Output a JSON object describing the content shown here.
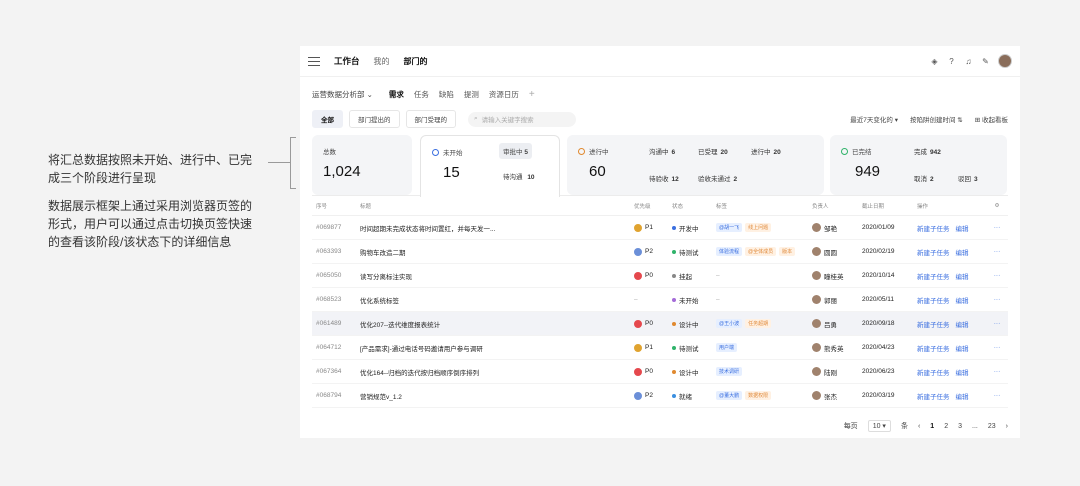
{
  "annotations": {
    "line1": "将汇总数据按照未开始、进行中、已完成三个阶段进行呈现",
    "line2": "数据展示框架上通过采用浏览器页签的形式，用户可以通过点击切换页签快速的查看该阶段/该状态下的详细信息"
  },
  "topbar": {
    "workbench": "工作台",
    "mine": "我的",
    "department": "部门的"
  },
  "subnav": {
    "project": "运营数据分析部",
    "tabs": [
      "需求",
      "任务",
      "缺陷",
      "提测",
      "资源日历"
    ],
    "plus": "+"
  },
  "filters": {
    "pills": [
      "全部",
      "部门提出的",
      "部门受理的"
    ],
    "search_placeholder": "请输入关键字搜索",
    "recent": "最近7天变化的",
    "sort": "按陷阱创建时间",
    "collapse": "收起看板"
  },
  "cards": {
    "total": {
      "label": "总数",
      "value": "1,024"
    },
    "not_started": {
      "label": "未开始",
      "value": "15",
      "sub1_label": "审批中",
      "sub1_value": "5",
      "sub2_label": "待沟通",
      "sub2_value": "10"
    },
    "in_progress": {
      "label": "进行中",
      "value": "60",
      "s1l": "沟通中",
      "s1v": "6",
      "s2l": "已受理",
      "s2v": "20",
      "s3l": "进行中",
      "s3v": "20",
      "s4l": "待验收",
      "s4v": "12",
      "s5l": "验收未通过",
      "s5v": "2"
    },
    "done": {
      "label": "已完结",
      "value": "949",
      "s1l": "完成",
      "s1v": "942",
      "s2l": "取消",
      "s2v": "2",
      "s3l": "驳回",
      "s3v": "3"
    }
  },
  "table": {
    "headers": [
      "序号",
      "标题",
      "优先级",
      "状态",
      "标签",
      "负责人",
      "截止日期",
      "操作"
    ],
    "rows": [
      {
        "id": "#069877",
        "title": "时间超期未完成状态将时间置红，并每天发一...",
        "pri": "P1",
        "status": "开发中",
        "tags": [
          "@胡一飞",
          "线上问题"
        ],
        "owner": "邹艳",
        "date": "2020/01/09"
      },
      {
        "id": "#063393",
        "title": "购物车改造二期",
        "pri": "P2",
        "status": "待测试",
        "tags": [
          "体验流程",
          "@全体成员",
          "版本"
        ],
        "owner": "圆圆",
        "date": "2020/02/19"
      },
      {
        "id": "#065050",
        "title": "读写分离标注实现",
        "pri": "P0",
        "status": "挂起",
        "tags": [
          "–"
        ],
        "owner": "瞳桂英",
        "date": "2020/10/14"
      },
      {
        "id": "#068523",
        "title": "优化系统标签",
        "pri": "–",
        "status": "未开始",
        "tags": [
          "–"
        ],
        "owner": "郭丽",
        "date": "2020/05/11"
      },
      {
        "id": "#061489",
        "title": "优化207--迭代维度报表统计",
        "pri": "P0",
        "status": "设计中",
        "tags": [
          "@王小波",
          "任务超期"
        ],
        "owner": "吕勇",
        "date": "2020/09/18"
      },
      {
        "id": "#064712",
        "title": "[产品需求]-通过电话号码邀请用户参与调研",
        "pri": "P1",
        "status": "待测试",
        "tags": [
          "用户端"
        ],
        "owner": "熊秀英",
        "date": "2020/04/23"
      },
      {
        "id": "#067364",
        "title": "优化164--归档的迭代按归档顺序倒序排列",
        "pri": "P0",
        "status": "设计中",
        "tags": [
          "技术调研"
        ],
        "owner": "陆刚",
        "date": "2020/06/23"
      },
      {
        "id": "#068794",
        "title": "营销规范v_1.2",
        "pri": "P2",
        "status": "就绪",
        "tags": [
          "@董大鹏",
          "数据权限"
        ],
        "owner": "张杰",
        "date": "2020/03/19"
      }
    ],
    "action_new": "新建子任务",
    "action_edit": "编辑",
    "more": "···"
  },
  "pager": {
    "per_page": "每页",
    "size": "10",
    "unit": "条",
    "p1": "1",
    "p2": "2",
    "p3": "3",
    "ellipsis": "...",
    "last": "23"
  }
}
